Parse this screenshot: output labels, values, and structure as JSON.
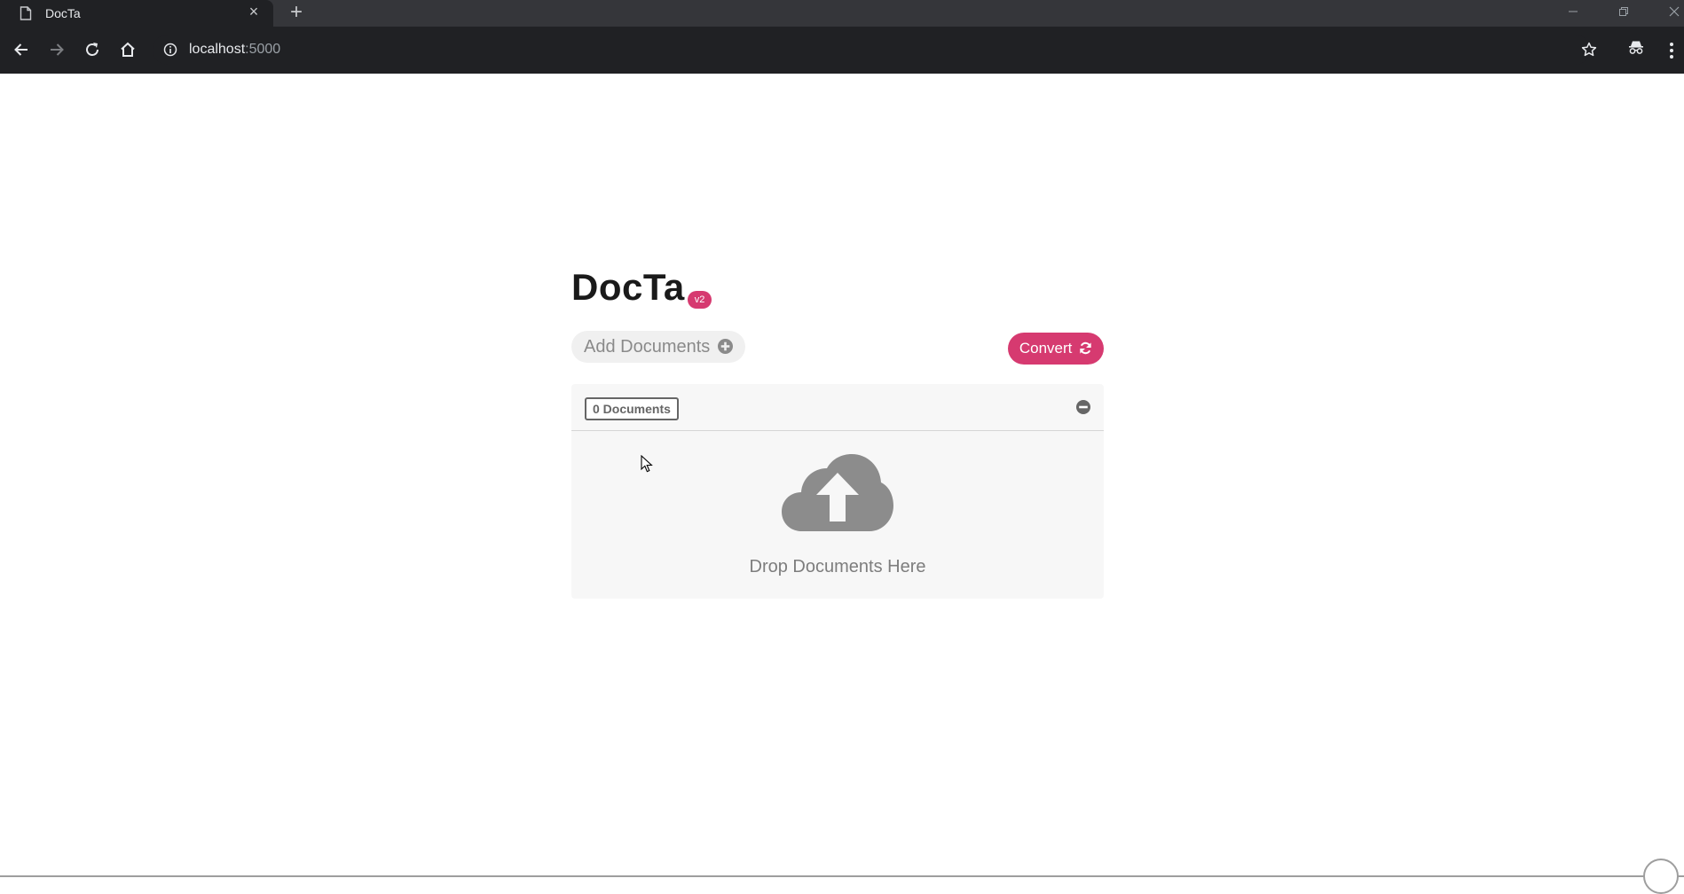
{
  "browser": {
    "tab_title": "DocTa",
    "new_tab_symbol": "+",
    "close_tab_symbol": "×",
    "url_host": "localhost",
    "url_port": ":5000",
    "icons": [
      "page-icon",
      "back-icon",
      "forward-icon",
      "reload-icon",
      "home-icon",
      "info-icon",
      "star-icon",
      "incognito-icon",
      "menu-icon",
      "minimize-icon",
      "restore-icon",
      "close-window-icon"
    ]
  },
  "app": {
    "title": "DocTa",
    "version_badge": "v2",
    "add_documents_label": "Add Documents",
    "convert_label": "Convert",
    "document_count": "0 Documents",
    "drop_text": "Drop Documents Here",
    "icons": [
      "plus-circle-icon",
      "refresh-icon",
      "minus-circle-icon",
      "cloud-upload-icon"
    ]
  },
  "colors": {
    "accent": "#d63a70",
    "muted_text": "#7d7d7d",
    "icon_gray": "#8c8c8c",
    "chrome_dark": "#202124"
  }
}
